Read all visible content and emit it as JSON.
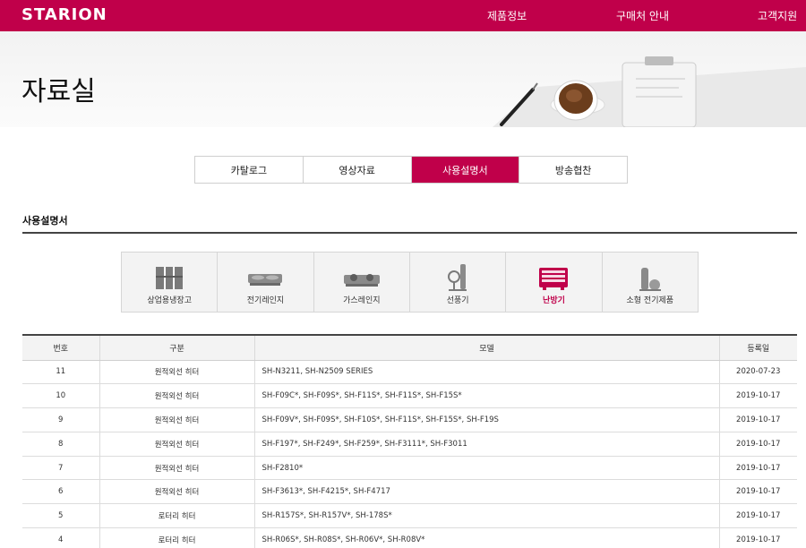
{
  "header": {
    "logo": "STARION",
    "nav": [
      "제품정보",
      "구매처 안내",
      "고객지원"
    ],
    "brand_color": "#c0004a"
  },
  "hero": {
    "title": "자료실"
  },
  "tabs": [
    {
      "label": "카탈로그",
      "active": false
    },
    {
      "label": "영상자료",
      "active": false
    },
    {
      "label": "사용설명서",
      "active": true
    },
    {
      "label": "방송협찬",
      "active": false
    }
  ],
  "section": {
    "title": "사용설명서"
  },
  "categories": [
    {
      "label": "상업용냉장고",
      "icon": "commercial-fridge-icon",
      "active": false
    },
    {
      "label": "전기레인지",
      "icon": "electric-range-icon",
      "active": false
    },
    {
      "label": "가스레인지",
      "icon": "gas-range-icon",
      "active": false
    },
    {
      "label": "선풍기",
      "icon": "fan-icon",
      "active": false
    },
    {
      "label": "난방기",
      "icon": "heater-icon",
      "active": true
    },
    {
      "label": "소형 전기제품",
      "icon": "small-appliance-icon",
      "active": false
    }
  ],
  "table": {
    "headers": [
      "번호",
      "구분",
      "모델",
      "등록일"
    ],
    "rows": [
      {
        "no": "11",
        "category": "원적외선 히터",
        "model": "SH-N3211, SH-N2509 SERIES",
        "date": "2020-07-23"
      },
      {
        "no": "10",
        "category": "원적외선 히터",
        "model": "SH-F09C*, SH-F09S*, SH-F11S*, SH-F11S*, SH-F15S*",
        "date": "2019-10-17"
      },
      {
        "no": "9",
        "category": "원적외선 히터",
        "model": "SH-F09V*, SH-F09S*, SH-F10S*, SH-F11S*, SH-F15S*, SH-F19S",
        "date": "2019-10-17"
      },
      {
        "no": "8",
        "category": "원적외선 히터",
        "model": "SH-F197*, SH-F249*, SH-F259*, SH-F3111*, SH-F3011",
        "date": "2019-10-17"
      },
      {
        "no": "7",
        "category": "원적외선 히터",
        "model": "SH-F2810*",
        "date": "2019-10-17"
      },
      {
        "no": "6",
        "category": "원적외선 히터",
        "model": "SH-F3613*, SH-F4215*, SH-F4717",
        "date": "2019-10-17"
      },
      {
        "no": "5",
        "category": "로터리 히터",
        "model": "SH-R157S*, SH-R157V*, SH-178S*",
        "date": "2019-10-17"
      },
      {
        "no": "4",
        "category": "로터리 히터",
        "model": "SH-R06S*, SH-R08S*, SH-R06V*, SH-R08V*",
        "date": "2019-10-17"
      }
    ]
  }
}
